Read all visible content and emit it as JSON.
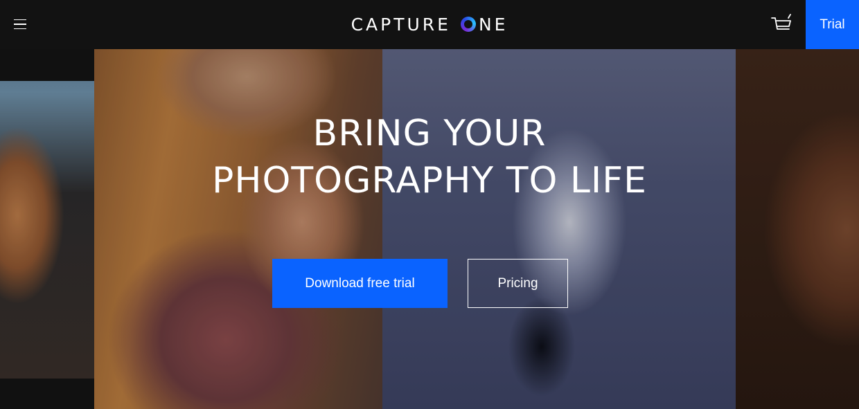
{
  "header": {
    "logo_left": "CAPTURE",
    "logo_right": "NE",
    "trial_label": "Trial",
    "menu_icon": "hamburger-menu-icon",
    "cart_icon": "shopping-cart-icon"
  },
  "hero": {
    "title_line1": "BRING YOUR",
    "title_line2": "PHOTOGRAPHY TO LIFE",
    "download_label": "Download free trial",
    "pricing_label": "Pricing"
  },
  "colors": {
    "header_bg": "#121212",
    "accent_blue": "#0a63ff",
    "text": "#ffffff"
  }
}
